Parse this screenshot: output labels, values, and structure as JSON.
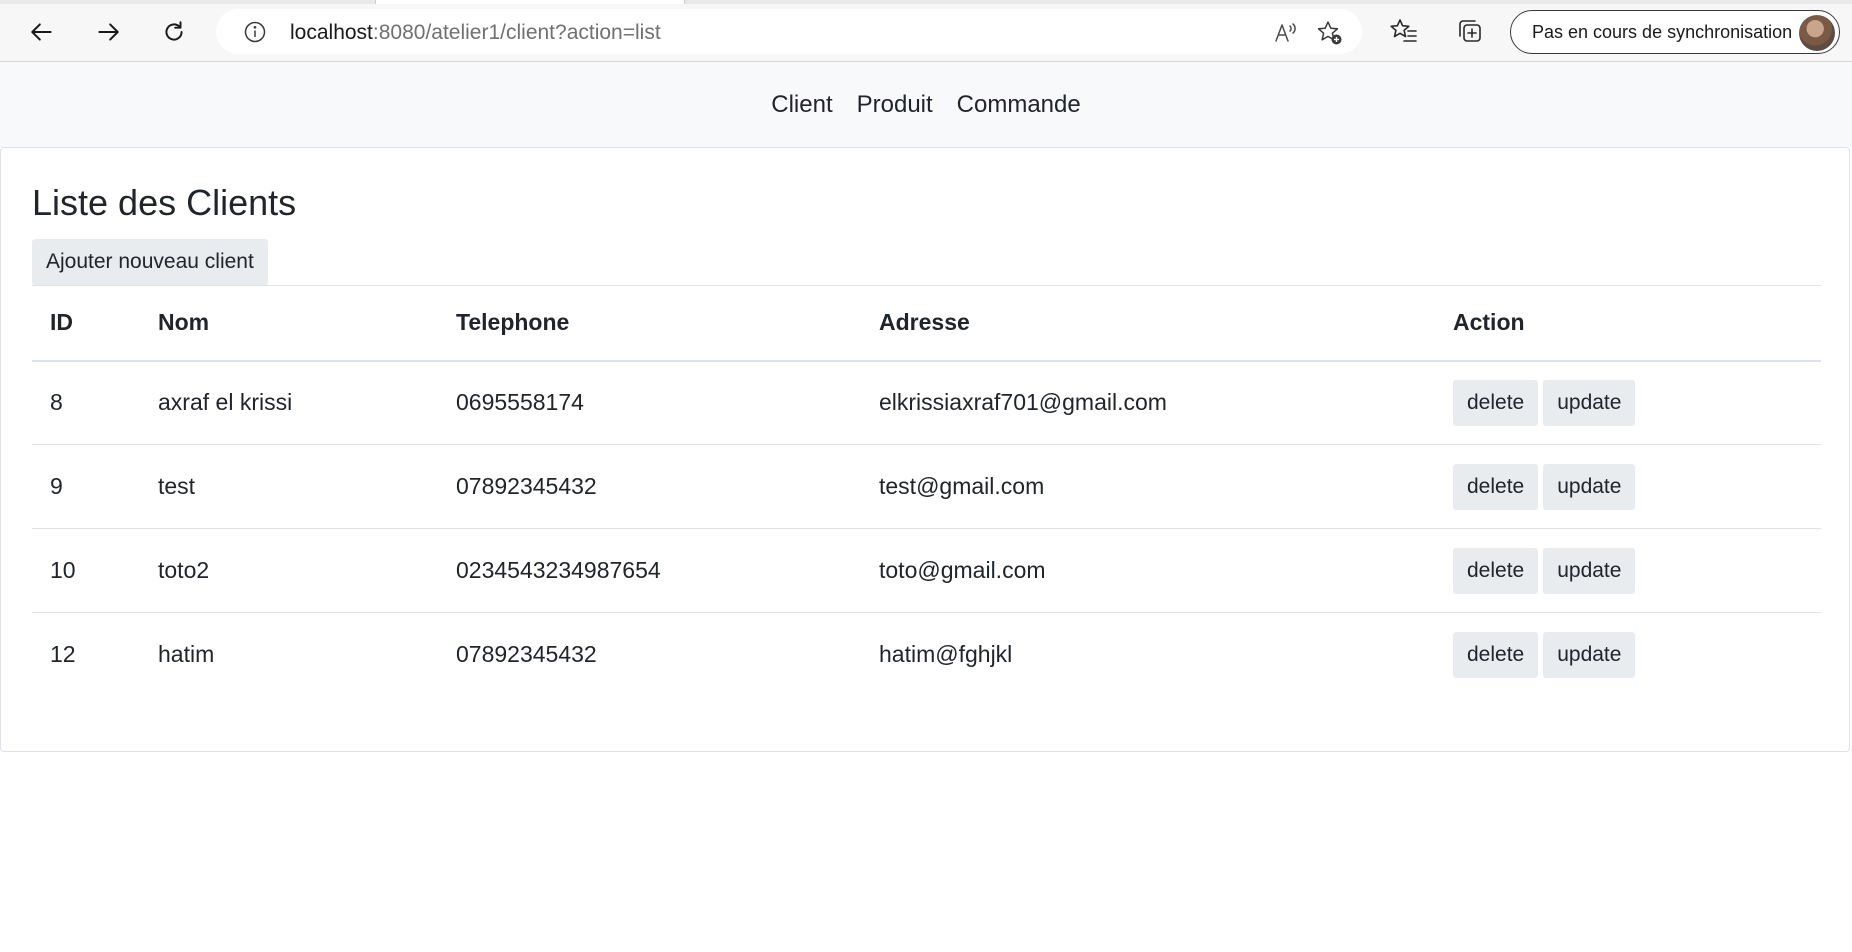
{
  "browser": {
    "url_host": "localhost",
    "url_rest": ":8080/atelier1/client?action=list",
    "profile_label": "Pas en cours de synchronisation",
    "icons": {
      "back": "back-arrow-icon",
      "forward": "forward-arrow-icon",
      "refresh": "refresh-icon",
      "site_info": "info-icon",
      "read_aloud": "read-aloud-icon",
      "add_favorite": "add-favorite-icon",
      "favorites": "favorites-icon",
      "collections": "collections-icon"
    }
  },
  "nav": {
    "items": [
      {
        "label": "Client"
      },
      {
        "label": "Produit"
      },
      {
        "label": "Commande"
      }
    ]
  },
  "main": {
    "title": "Liste des Clients",
    "add_button": "Ajouter nouveau client",
    "table": {
      "headers": [
        "ID",
        "Nom",
        "Telephone",
        "Adresse",
        "Action"
      ],
      "rows": [
        {
          "id": "8",
          "nom": "axraf el krissi",
          "telephone": "0695558174",
          "adresse": "elkrissiaxraf701@gmail.com",
          "delete": "delete",
          "update": "update"
        },
        {
          "id": "9",
          "nom": "test",
          "telephone": "07892345432",
          "adresse": "test@gmail.com",
          "delete": "delete",
          "update": "update"
        },
        {
          "id": "10",
          "nom": "toto2",
          "telephone": "0234543234987654",
          "adresse": "toto@gmail.com",
          "delete": "delete",
          "update": "update"
        },
        {
          "id": "12",
          "nom": "hatim",
          "telephone": "07892345432",
          "adresse": "hatim@fghjkl",
          "delete": "delete",
          "update": "update"
        }
      ]
    }
  }
}
